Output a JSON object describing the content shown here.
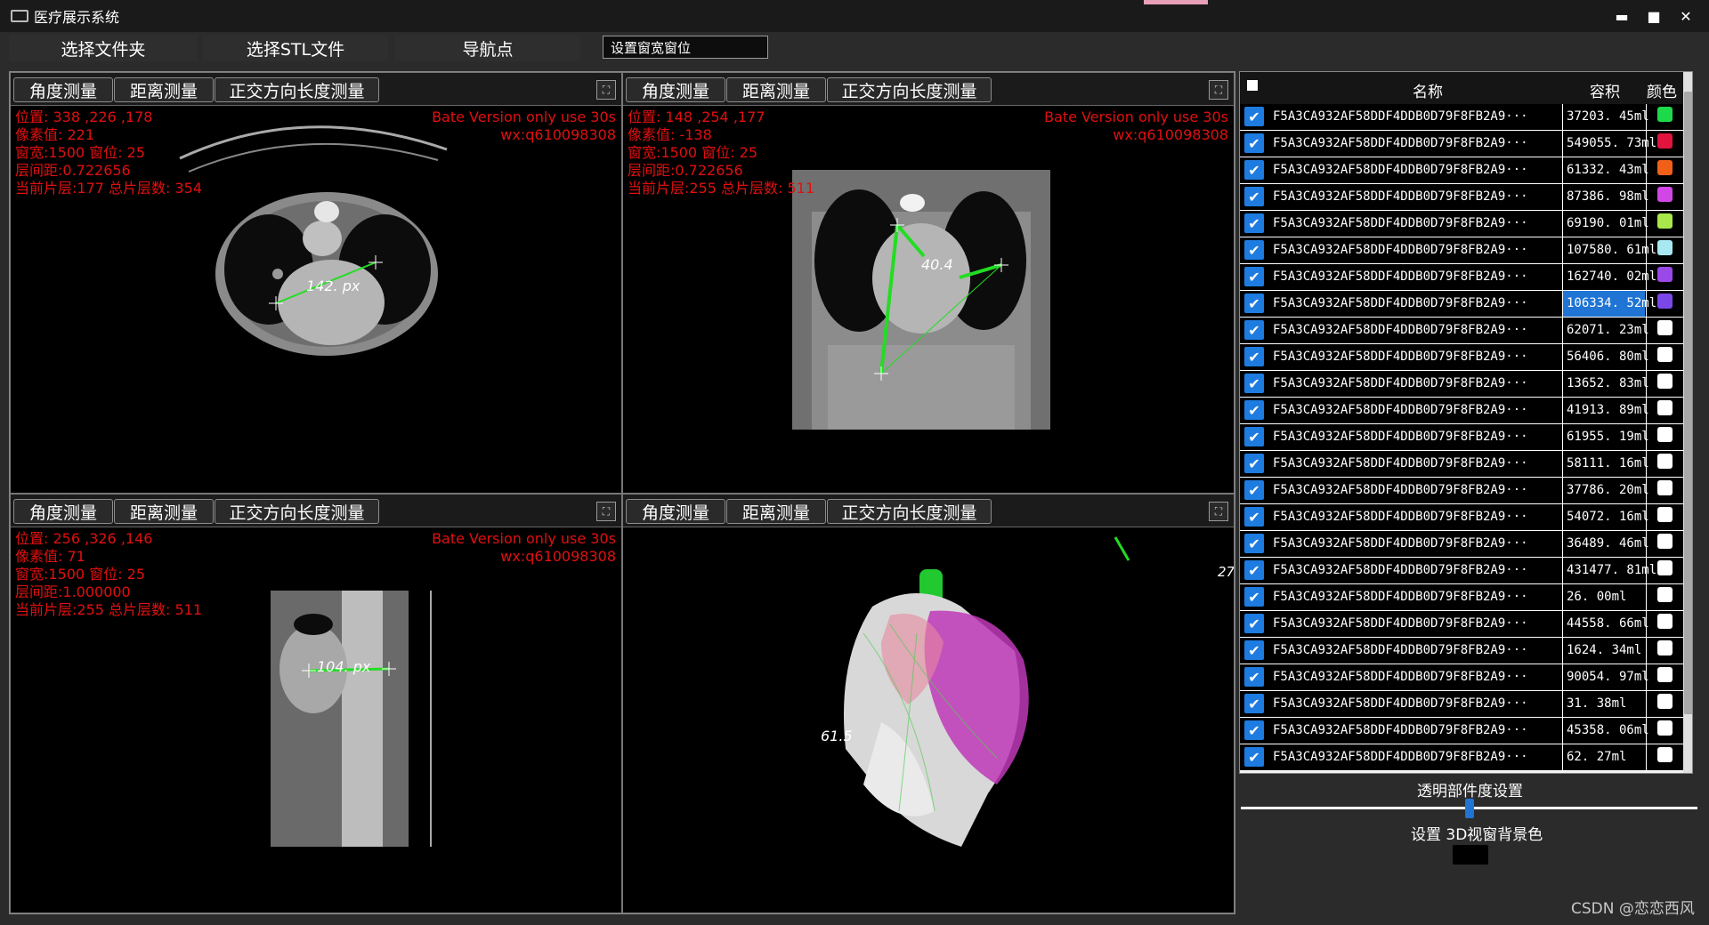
{
  "window": {
    "title": "医疗展示系统",
    "minimize": "▬",
    "maximize": "■",
    "close": "✕"
  },
  "toolbar": {
    "select_folder": "选择文件夹",
    "select_stl": "选择STL文件",
    "nav_points": "导航点",
    "window_level_input": "设置窗宽窗位"
  },
  "viewports": {
    "btn_angle": "角度测量",
    "btn_distance": "距离测量",
    "btn_ortho": "正交方向长度测量",
    "bate_line1": "Bate Version only use 30s",
    "bate_line2": "wx:q610098308",
    "axial": {
      "pos": "位置: 338 ,226  ,178",
      "pixel": "像素值: 221",
      "window": "窗宽:1500 窗位:  25",
      "spacing": "层间距:0.722656",
      "slice": "当前片层:177 总片层数:  354",
      "measure": "142.  px"
    },
    "coronal": {
      "pos": "位置: 148 ,254  ,177",
      "pixel": "像素值: -138",
      "window": "窗宽:1500 窗位:  25",
      "spacing": "层间距:0.722656",
      "slice": "当前片层:255 总片层数:  511",
      "measure": "40.4"
    },
    "sagittal": {
      "pos": "位置: 256 ,326  ,146",
      "pixel": "像素值: 71",
      "window": "窗宽:1500 窗位:  25",
      "spacing": "层间距:1.000000",
      "slice": "当前片层:255 总片层数:  511",
      "measure": "104.  px"
    },
    "threed": {
      "measure1": "61.5",
      "measure2": "27"
    }
  },
  "table": {
    "header_name": "名称",
    "header_volume": "容积",
    "header_color": "颜色",
    "rows": [
      {
        "name": "F5A3CA932AF58DDF4DDB0D79F8FB2A9···",
        "volume": "37203. 45ml",
        "color": "#1ed94a"
      },
      {
        "name": "F5A3CA932AF58DDF4DDB0D79F8FB2A9···",
        "volume": "549055. 73ml",
        "color": "#e0143c"
      },
      {
        "name": "F5A3CA932AF58DDF4DDB0D79F8FB2A9···",
        "volume": "61332. 43ml",
        "color": "#f06018"
      },
      {
        "name": "F5A3CA932AF58DDF4DDB0D79F8FB2A9···",
        "volume": "87386. 98ml",
        "color": "#d047e6"
      },
      {
        "name": "F5A3CA932AF58DDF4DDB0D79F8FB2A9···",
        "volume": "69190. 01ml",
        "color": "#a8e84a"
      },
      {
        "name": "F5A3CA932AF58DDF4DDB0D79F8FB2A9···",
        "volume": "107580. 61ml",
        "color": "#a8e8f0"
      },
      {
        "name": "F5A3CA932AF58DDF4DDB0D79F8FB2A9···",
        "volume": "162740. 02ml",
        "color": "#9a48e8"
      },
      {
        "name": "F5A3CA932AF58DDF4DDB0D79F8FB2A9···",
        "volume": "106334. 52ml",
        "color": "#7a48e8",
        "selected": true
      },
      {
        "name": "F5A3CA932AF58DDF4DDB0D79F8FB2A9···",
        "volume": "62071. 23ml",
        "color": "#ffffff"
      },
      {
        "name": "F5A3CA932AF58DDF4DDB0D79F8FB2A9···",
        "volume": "56406. 80ml",
        "color": "#ffffff"
      },
      {
        "name": "F5A3CA932AF58DDF4DDB0D79F8FB2A9···",
        "volume": "13652. 83ml",
        "color": "#ffffff"
      },
      {
        "name": "F5A3CA932AF58DDF4DDB0D79F8FB2A9···",
        "volume": "41913. 89ml",
        "color": "#ffffff"
      },
      {
        "name": "F5A3CA932AF58DDF4DDB0D79F8FB2A9···",
        "volume": "61955. 19ml",
        "color": "#ffffff"
      },
      {
        "name": "F5A3CA932AF58DDF4DDB0D79F8FB2A9···",
        "volume": "58111. 16ml",
        "color": "#ffffff"
      },
      {
        "name": "F5A3CA932AF58DDF4DDB0D79F8FB2A9···",
        "volume": "37786. 20ml",
        "color": "#ffffff"
      },
      {
        "name": "F5A3CA932AF58DDF4DDB0D79F8FB2A9···",
        "volume": "54072. 16ml",
        "color": "#ffffff"
      },
      {
        "name": "F5A3CA932AF58DDF4DDB0D79F8FB2A9···",
        "volume": "36489. 46ml",
        "color": "#ffffff"
      },
      {
        "name": "F5A3CA932AF58DDF4DDB0D79F8FB2A9···",
        "volume": "431477. 81ml",
        "color": "#ffffff"
      },
      {
        "name": "F5A3CA932AF58DDF4DDB0D79F8FB2A9···",
        "volume": "26. 00ml",
        "color": "#ffffff"
      },
      {
        "name": "F5A3CA932AF58DDF4DDB0D79F8FB2A9···",
        "volume": "44558. 66ml",
        "color": "#ffffff"
      },
      {
        "name": "F5A3CA932AF58DDF4DDB0D79F8FB2A9···",
        "volume": "1624. 34ml",
        "color": "#ffffff"
      },
      {
        "name": "F5A3CA932AF58DDF4DDB0D79F8FB2A9···",
        "volume": "90054. 97ml",
        "color": "#ffffff"
      },
      {
        "name": "F5A3CA932AF58DDF4DDB0D79F8FB2A9···",
        "volume": "31. 38ml",
        "color": "#ffffff"
      },
      {
        "name": "F5A3CA932AF58DDF4DDB0D79F8FB2A9···",
        "volume": "45358. 06ml",
        "color": "#ffffff"
      },
      {
        "name": "F5A3CA932AF58DDF4DDB0D79F8FB2A9···",
        "volume": "62. 27ml",
        "color": "#ffffff"
      }
    ]
  },
  "panel": {
    "transparency_label": "透明部件度设置",
    "transparency_value": 0.5,
    "bg_label": "设置  3D视窗背景色",
    "bg_color": "#000000"
  },
  "watermark": "CSDN @恋恋西风"
}
